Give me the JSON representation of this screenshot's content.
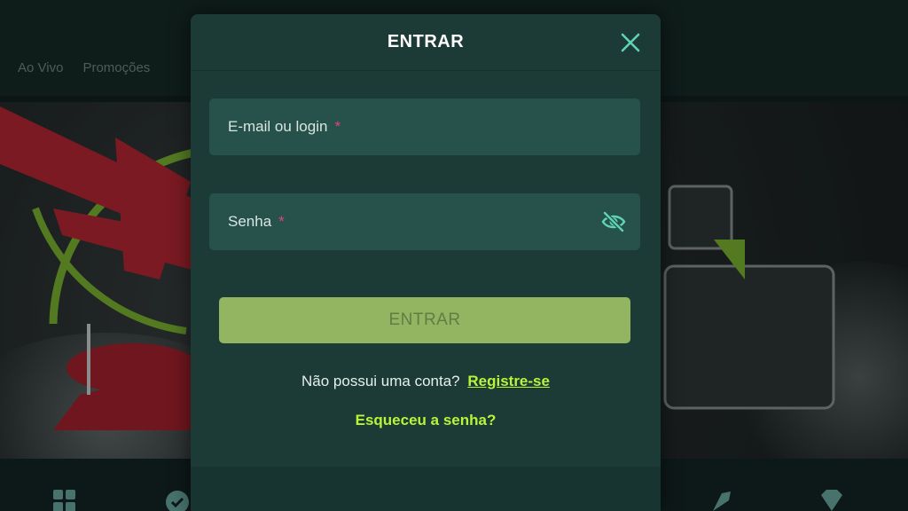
{
  "background": {
    "nav": [
      "Ao Vivo",
      "Promoções"
    ]
  },
  "modal": {
    "title": "ENTRAR",
    "email_label": "E-mail ou login",
    "password_label": "Senha",
    "required_mark": "*",
    "submit_label": "ENTRAR",
    "no_account_text": "Não possui uma conta?",
    "register_link": "Registre-se",
    "forgot_link": "Esqueceu a senha?"
  },
  "colors": {
    "accent": "#b7f53a",
    "submit_bg": "#93b562",
    "modal_bg": "#1c3b36",
    "field_bg": "#26524b",
    "required": "#e0467a"
  },
  "icons": [
    "close-icon",
    "eye-off-icon",
    "grid-icon",
    "badge-icon",
    "rocket-icon",
    "diamond-icon"
  ]
}
